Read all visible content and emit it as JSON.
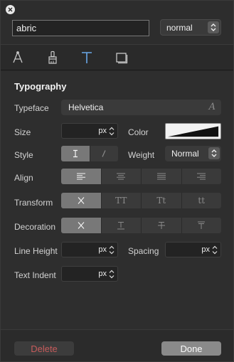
{
  "header": {
    "name_value": "abric",
    "state_value": "normal"
  },
  "tabs": [
    {
      "icon": "pen-tool-icon"
    },
    {
      "icon": "brush-icon"
    },
    {
      "icon": "text-icon"
    },
    {
      "icon": "rectangle-icon"
    }
  ],
  "typography": {
    "title": "Typography",
    "typeface_label": "Typeface",
    "typeface_value": "Helvetica",
    "size_label": "Size",
    "size_unit": "px",
    "color_label": "Color",
    "style_label": "Style",
    "weight_label": "Weight",
    "weight_value": "Normal",
    "align_label": "Align",
    "transform_label": "Transform",
    "transform_options": [
      "TT",
      "Tt",
      "tt"
    ],
    "decoration_label": "Decoration",
    "line_height_label": "Line Height",
    "line_height_unit": "px",
    "spacing_label": "Spacing",
    "spacing_unit": "px",
    "text_indent_label": "Text Indent",
    "text_indent_unit": "px"
  },
  "footer": {
    "delete_label": "Delete",
    "done_label": "Done"
  },
  "colors": {
    "panel_bg": "#2e2e2e",
    "active_segment": "#787878",
    "delete_text": "#c65b5b"
  }
}
